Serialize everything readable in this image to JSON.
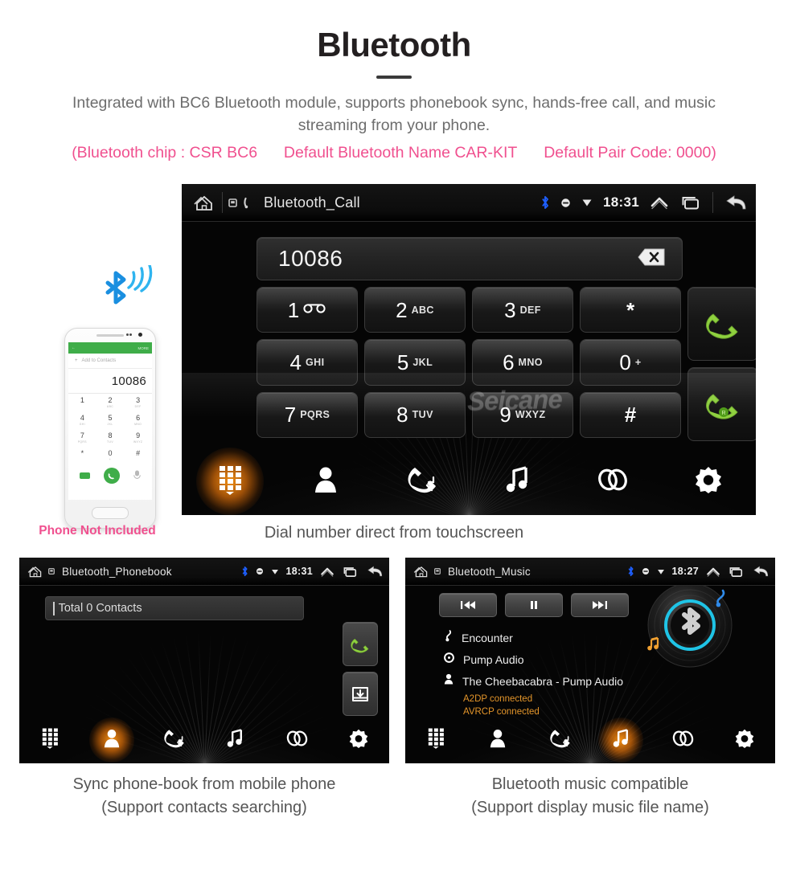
{
  "header": {
    "title": "Bluetooth",
    "intro": "Integrated with BC6 Bluetooth module, supports phonebook sync, hands-free call, and music streaming from your phone.",
    "specs": {
      "chip": "(Bluetooth chip : CSR BC6",
      "name": "Default Bluetooth Name CAR-KIT",
      "pair": "Default Pair Code: 0000)"
    },
    "accent_pink": "#f0508f",
    "text_gray": "#6d6d6d"
  },
  "main_screen": {
    "statusbar": {
      "home_icon": "home-icon",
      "sim_icon": "sim-card-icon",
      "phone_icon": "phone-handset-icon",
      "title": "Bluetooth_Call",
      "bluetooth_icon": "bluetooth-icon",
      "mute_icon": "mute-dot-icon",
      "download_icon": "download-triangle-icon",
      "time": "18:31",
      "expand_icon": "chevron-up-icon",
      "recents_icon": "recent-apps-icon",
      "back_icon": "back-arrow-icon"
    },
    "dial_value": "10086",
    "delete_icon": "backspace-icon",
    "keys": [
      {
        "digit": "1",
        "letters": "",
        "icon": "voicemail-icon"
      },
      {
        "digit": "2",
        "letters": "ABC",
        "icon": ""
      },
      {
        "digit": "3",
        "letters": "DEF",
        "icon": ""
      },
      {
        "digit": "*",
        "letters": "",
        "icon": ""
      },
      {
        "digit": "4",
        "letters": "GHI",
        "icon": ""
      },
      {
        "digit": "5",
        "letters": "JKL",
        "icon": ""
      },
      {
        "digit": "6",
        "letters": "MNO",
        "icon": ""
      },
      {
        "digit": "0",
        "letters": "+",
        "icon": ""
      },
      {
        "digit": "7",
        "letters": "PQRS",
        "icon": ""
      },
      {
        "digit": "8",
        "letters": "TUV",
        "icon": ""
      },
      {
        "digit": "9",
        "letters": "WXYZ",
        "icon": ""
      },
      {
        "digit": "#",
        "letters": "",
        "icon": ""
      }
    ],
    "call_button_icon": "call-handset-icon",
    "transfer_button_icon": "call-transfer-icon",
    "watermark": "Seicane",
    "nav": [
      {
        "name": "keypad",
        "icon": "keypad-icon",
        "active": true
      },
      {
        "name": "contacts",
        "icon": "contact-person-icon",
        "active": false
      },
      {
        "name": "call-history",
        "icon": "call-history-icon",
        "active": false
      },
      {
        "name": "music",
        "icon": "music-note-icon",
        "active": false
      },
      {
        "name": "pair",
        "icon": "link-chain-icon",
        "active": false
      },
      {
        "name": "settings",
        "icon": "gear-icon",
        "active": false
      }
    ],
    "caption": "Dial number direct from touchscreen",
    "accent_orange": "#ff8c10",
    "call_green": "#8fd13f"
  },
  "phone_mockup": {
    "bluetooth_signal_icon": "bluetooth-signal-icon",
    "app_bar_back": "←",
    "app_bar_more": "MORE",
    "add_to_contacts": "Add to Contacts",
    "number": "10086",
    "keys": [
      {
        "d": "1",
        "s": ""
      },
      {
        "d": "2",
        "s": "ABC"
      },
      {
        "d": "3",
        "s": "DEF"
      },
      {
        "d": "4",
        "s": "GHI"
      },
      {
        "d": "5",
        "s": "JKL"
      },
      {
        "d": "6",
        "s": "MNO"
      },
      {
        "d": "7",
        "s": "PQRS"
      },
      {
        "d": "8",
        "s": "TUV"
      },
      {
        "d": "9",
        "s": "WXYZ"
      },
      {
        "d": "*",
        "s": ""
      },
      {
        "d": "0",
        "s": "+"
      },
      {
        "d": "#",
        "s": ""
      }
    ],
    "voicemail_icon": "voicemail-icon",
    "call_icon": "call-handset-icon",
    "keyboard_icon": "keyboard-icon",
    "note": "Phone Not Included",
    "note_color": "#f0508f"
  },
  "phonebook_screen": {
    "statusbar": {
      "home_icon": "home-icon",
      "sim_icon": "sim-card-icon",
      "title": "Bluetooth_Phonebook",
      "bluetooth_icon": "bluetooth-icon",
      "mute_icon": "mute-dot-icon",
      "download_icon": "download-triangle-icon",
      "time": "18:31",
      "expand_icon": "chevron-up-icon",
      "recents_icon": "recent-apps-icon",
      "back_icon": "back-arrow-icon"
    },
    "search_text": "Total 0 Contacts",
    "call_button_icon": "call-handset-icon",
    "download_button_icon": "download-contacts-icon",
    "nav": [
      {
        "name": "keypad",
        "icon": "keypad-icon",
        "active": false
      },
      {
        "name": "contacts",
        "icon": "contact-person-icon",
        "active": true
      },
      {
        "name": "call-history",
        "icon": "call-history-icon",
        "active": false
      },
      {
        "name": "music",
        "icon": "music-note-icon",
        "active": false
      },
      {
        "name": "pair",
        "icon": "link-chain-icon",
        "active": false
      },
      {
        "name": "settings",
        "icon": "gear-icon",
        "active": false
      }
    ],
    "caption_line1": "Sync phone-book from mobile phone",
    "caption_line2": "(Support contacts searching)"
  },
  "music_screen": {
    "statusbar": {
      "home_icon": "home-icon",
      "sim_icon": "sim-card-icon",
      "title": "Bluetooth_Music",
      "bluetooth_icon": "bluetooth-icon",
      "mute_icon": "mute-dot-icon",
      "download_icon": "download-triangle-icon",
      "time": "18:27",
      "expand_icon": "chevron-up-icon",
      "recents_icon": "recent-apps-icon",
      "back_icon": "back-arrow-icon"
    },
    "transport": [
      {
        "name": "previous",
        "icon": "previous-track-icon"
      },
      {
        "name": "pause",
        "icon": "pause-icon"
      },
      {
        "name": "next",
        "icon": "next-track-icon"
      }
    ],
    "track": {
      "title": "Encounter",
      "album": "Pump Audio",
      "artist": "The Cheebacabra - Pump Audio",
      "title_icon": "music-note-small-icon",
      "album_icon": "disc-icon",
      "artist_icon": "contact-person-icon"
    },
    "status": [
      "A2DP connected",
      "AVRCP connected"
    ],
    "status_color": "#e3952a",
    "disc_icon": "bluetooth-vinyl-disc-icon",
    "nav": [
      {
        "name": "keypad",
        "icon": "keypad-icon",
        "active": false
      },
      {
        "name": "contacts",
        "icon": "contact-person-icon",
        "active": false
      },
      {
        "name": "call-history",
        "icon": "call-history-icon",
        "active": false
      },
      {
        "name": "music",
        "icon": "music-note-icon",
        "active": true
      },
      {
        "name": "pair",
        "icon": "link-chain-icon",
        "active": false
      },
      {
        "name": "settings",
        "icon": "gear-icon",
        "active": false
      }
    ],
    "caption_line1": "Bluetooth music compatible",
    "caption_line2": "(Support display music file name)"
  }
}
